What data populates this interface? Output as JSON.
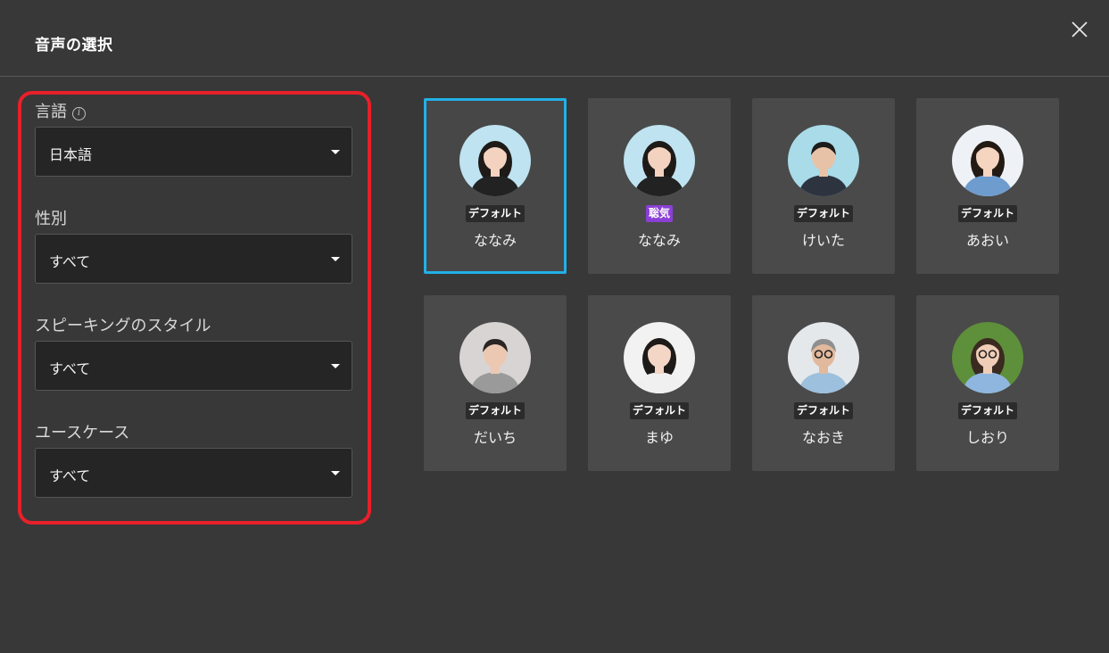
{
  "dialog": {
    "title": "音声の選択"
  },
  "filters": {
    "language": {
      "label": "言語",
      "value": "日本語"
    },
    "gender": {
      "label": "性別",
      "value": "すべて"
    },
    "speaking_style": {
      "label": "スピーキングのスタイル",
      "value": "すべて"
    },
    "use_case": {
      "label": "ユースケース",
      "value": "すべて"
    }
  },
  "voices": [
    {
      "name": "ななみ",
      "badge": "デフォルト",
      "selected": true,
      "avatar_bg": "#bfe3f0",
      "avatar": "woman-suit-avatar"
    },
    {
      "name": "ななみ",
      "badge": "聡気",
      "badge_color": "#8b3fd6",
      "avatar_bg": "#bfe3f0",
      "avatar": "woman-suit-avatar"
    },
    {
      "name": "けいた",
      "badge": "デフォルト",
      "avatar_bg": "#a9dbe9",
      "avatar": "man-suit-avatar"
    },
    {
      "name": "あおい",
      "badge": "デフォルト",
      "avatar_bg": "#eef2f6",
      "avatar": "girl-avatar"
    },
    {
      "name": "だいち",
      "badge": "デフォルト",
      "avatar_bg": "#d8d4d4",
      "avatar": "man-jacket-avatar"
    },
    {
      "name": "まゆ",
      "badge": "デフォルト",
      "avatar_bg": "#f2f2f2",
      "avatar": "woman-avatar"
    },
    {
      "name": "なおき",
      "badge": "デフォルト",
      "avatar_bg": "#e4e8ea",
      "avatar": "older-man-avatar"
    },
    {
      "name": "しおり",
      "badge": "デフォルト",
      "avatar_bg": "#5e8f3a",
      "avatar": "woman-glasses-avatar"
    }
  ],
  "colors": {
    "selected_border": "#22b0e6",
    "highlight": "#e8202a",
    "background": "#383838"
  }
}
